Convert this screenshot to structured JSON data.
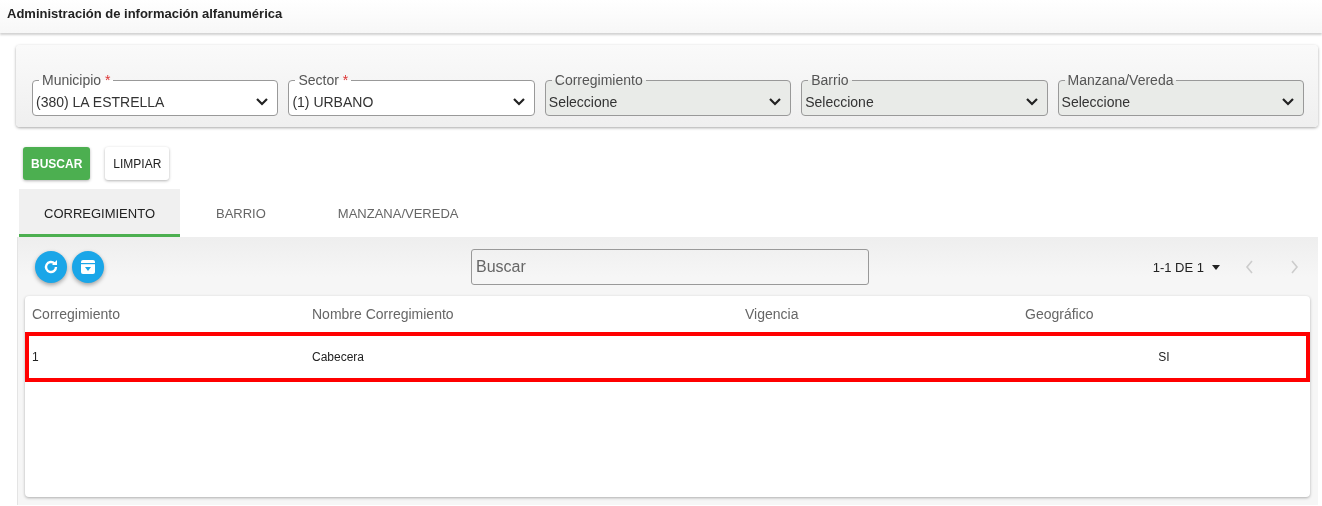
{
  "window": {
    "title": "Administración de información alfanumérica"
  },
  "filters": [
    {
      "label": "Municipio",
      "required_mark": "*",
      "value": "(380) LA ESTRELLA",
      "disabled": false
    },
    {
      "label": "Sector",
      "required_mark": "*",
      "value": "(1) URBANO",
      "disabled": false
    },
    {
      "label": "Corregimiento",
      "value": "Seleccione",
      "disabled": true
    },
    {
      "label": "Barrio",
      "value": "Seleccione",
      "disabled": true
    },
    {
      "label": "Manzana/Vereda",
      "value": "Seleccione",
      "disabled": true
    }
  ],
  "buttons": [
    {
      "label": "BUSCAR",
      "kind": "primary"
    },
    {
      "label": "LIMPIAR",
      "kind": "plain"
    }
  ],
  "tabs": [
    {
      "label": "CORREGIMIENTO",
      "selected": true
    },
    {
      "label": "BARRIO",
      "selected": false
    },
    {
      "label": "MANZANA/VEREDA",
      "selected": false
    }
  ],
  "toolbar": {
    "search": {
      "placeholder": "Buscar"
    },
    "pagination": "1-1 DE 1"
  },
  "table": {
    "columns": [
      "Corregimiento",
      "Nombre Corregimiento",
      "Vigencia",
      "Geográfico"
    ],
    "rows": [
      {
        "cells": [
          "1",
          "Cabecera",
          "",
          "SI"
        ],
        "highlighted": true
      }
    ]
  }
}
